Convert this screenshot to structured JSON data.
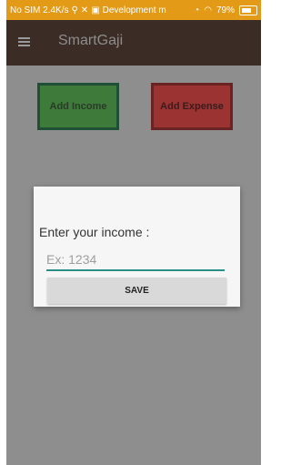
{
  "status_bar": {
    "left_text": "No SIM 2.4K/s",
    "notification": "Development m",
    "battery": "79%"
  },
  "app_bar": {
    "title": "SmartGaji",
    "menu_icon": "hamburger-menu-icon"
  },
  "buttons": {
    "add_income": "Add Income",
    "add_expense": "Add Expense"
  },
  "dialog": {
    "label": "Enter your income :",
    "input_value": "",
    "input_placeholder": "Ex: 1234",
    "save_label": "SAVE"
  },
  "colors": {
    "status_bar": "#e39a17",
    "app_bar": "#3b2c25",
    "income_button": "#3e7a3a",
    "expense_button": "#9b3332",
    "input_underline": "#2a8f86"
  }
}
